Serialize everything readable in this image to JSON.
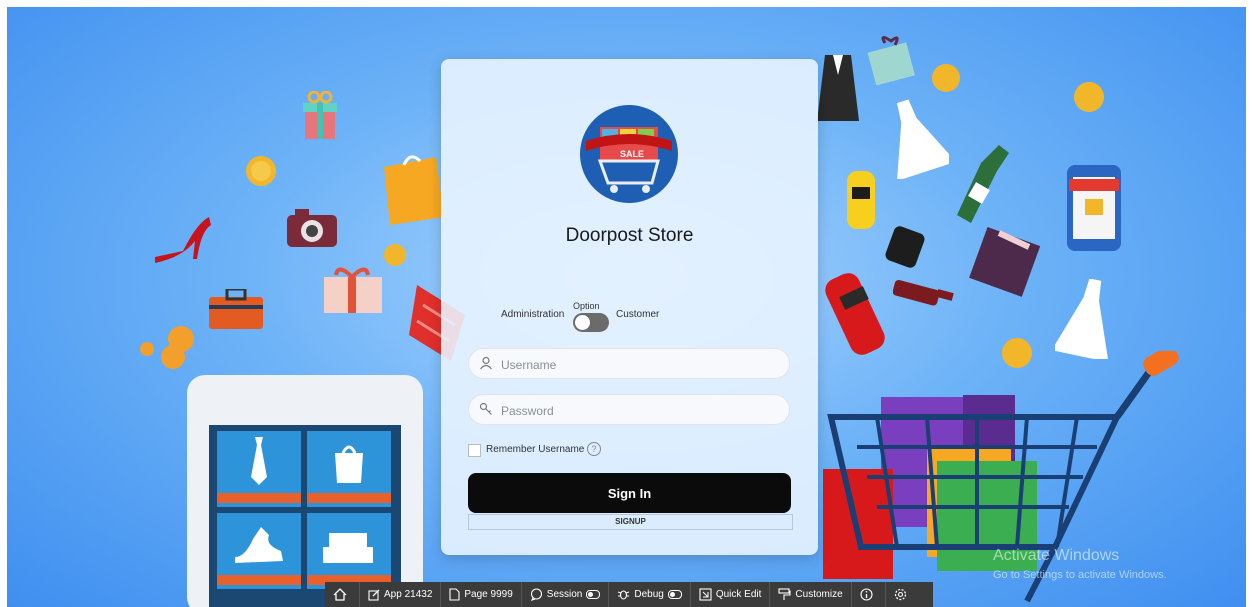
{
  "colors": {
    "background_start": "#a9d4ff",
    "background_end": "#3f8ff0",
    "signin_bg": "#0b0b0b",
    "toolbar_bg": "#3b3b3b",
    "toggle_bg": "#6b6b6b"
  },
  "login": {
    "logo_icon": "shopping-cart-sale-logo",
    "store_name": "Doorpost Store",
    "toggle": {
      "left_label": "Administration",
      "top_label": "Option",
      "right_label": "Customer",
      "state": "off"
    },
    "username": {
      "placeholder": "Username",
      "value": "",
      "icon": "user-icon"
    },
    "password": {
      "placeholder": "Password",
      "value": "",
      "icon": "key-icon"
    },
    "remember_label": "Remember Username",
    "remember_checked": false,
    "help_glyph": "?",
    "signin_label": "Sign In",
    "signup_label": "SIGNUP"
  },
  "watermark": {
    "line1": "Activate Windows",
    "line2": "Go to Settings to activate Windows."
  },
  "devbar": {
    "home_icon": "home-icon",
    "app_label": "App 21432",
    "page_label": "Page 9999",
    "session_label": "Session",
    "debug_label": "Debug",
    "quick_edit_label": "Quick Edit",
    "customize_label": "Customize",
    "info_icon": "info-icon",
    "settings_icon": "gear-icon"
  }
}
